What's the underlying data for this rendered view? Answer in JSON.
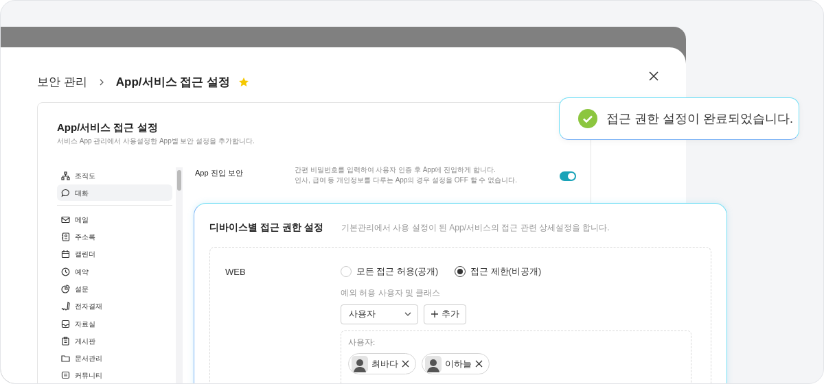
{
  "breadcrumb": {
    "parent": "보안 관리",
    "current": "App/서비스 접근 설정",
    "favorite": true
  },
  "card": {
    "title": "App/서비스 접근 설정",
    "subtitle": "서비스 App 관리에서 사용설정한 App별 보안 설정을 추가합니다."
  },
  "sidebar": {
    "groups": [
      [
        {
          "label": "조직도",
          "selected": false
        },
        {
          "label": "대화",
          "selected": true
        }
      ],
      [
        {
          "label": "메일",
          "selected": false
        },
        {
          "label": "주소록",
          "selected": false
        },
        {
          "label": "캘린더",
          "selected": false
        },
        {
          "label": "예약",
          "selected": false
        },
        {
          "label": "설문",
          "selected": false
        },
        {
          "label": "전자결재",
          "selected": false
        },
        {
          "label": "자료실",
          "selected": false
        },
        {
          "label": "게시판",
          "selected": false
        },
        {
          "label": "문서관리",
          "selected": false
        },
        {
          "label": "커뮤니티",
          "selected": false
        }
      ]
    ]
  },
  "settings": [
    {
      "label": "App 진입 보안",
      "description": [
        "간편 비밀번호를 입력하여 사용자 인증 후 App에 진입하게 합니다.",
        "인사, 급여 등 개인정보를 다루는 App의 경우 설정을 OFF 할 수 없습니다."
      ],
      "on": true
    }
  ],
  "device_panel": {
    "title": "디바이스별 접근 권한 설정",
    "description": "기본관리에서 사용 설정이 된 App/서비스의 접근 관련 상세설정을 합니다.",
    "rows": [
      {
        "label": "WEB",
        "options": [
          {
            "label": "모든 접근 허용(공개)",
            "selected": false
          },
          {
            "label": "접근 제한(비공개)",
            "selected": true
          }
        ],
        "exception_label": "예외 허용 사용자 및 클래스",
        "select": {
          "value": "사용자"
        },
        "add_button": "추가",
        "chip_box": {
          "label": "사용자:",
          "chips": [
            {
              "name": "최바다"
            },
            {
              "name": "이하늘"
            }
          ]
        }
      }
    ]
  },
  "toast": {
    "message": "접근 권한 설정이 완료되었습니다."
  }
}
